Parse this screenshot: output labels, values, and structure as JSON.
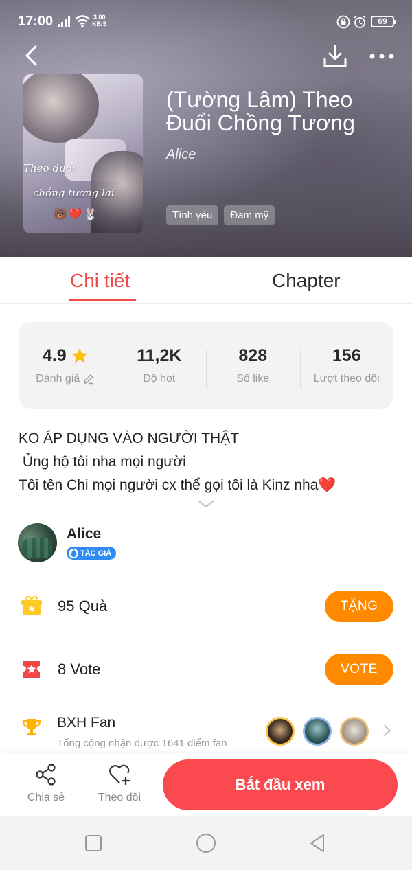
{
  "status_bar": {
    "time": "17:00",
    "speed_top": "3.00",
    "speed_bottom": "KB/S",
    "battery": "69"
  },
  "book": {
    "title": "(Tường Lâm) Theo Đuổi Chồng Tương",
    "author": "Alice",
    "cover_text_line1": "Theo đuổi",
    "cover_text_line2": "chồng tương lai",
    "cover_emoji": "🐻❤️🐰",
    "tags": [
      "Tình yêu",
      "Đam mỹ"
    ]
  },
  "tabs": [
    {
      "label": "Chi tiết",
      "active": true
    },
    {
      "label": "Chapter",
      "active": false
    }
  ],
  "stats": [
    {
      "value": "4.9",
      "label": "Đánh giá"
    },
    {
      "value": "11,2K",
      "label": "Độ hot"
    },
    {
      "value": "828",
      "label": "Số like"
    },
    {
      "value": "156",
      "label": "Lượt theo dõi"
    }
  ],
  "description": [
    "KO ÁP DỤNG VÀO NGƯỜI THẬT",
    " Ủng hộ tôi nha mọi người",
    "Tôi tên Chi mọi người cx thể gọi tôi là Kinz nha❤️"
  ],
  "author_section": {
    "name": "Alice",
    "badge": "TÁC GIẢ"
  },
  "gift_row": {
    "count": "95",
    "unit": "Quà",
    "button": "TẶNG"
  },
  "vote_row": {
    "count": "8",
    "unit": "Vote",
    "button": "VOTE"
  },
  "fan_row": {
    "title": "BXH Fan",
    "subtitle": "Tổng cộng nhận được 1641 điểm fan"
  },
  "bottom_bar": {
    "share": "Chia sẻ",
    "follow": "Theo dõi",
    "start": "Bắt đầu xem"
  },
  "colors": {
    "accent": "#f04747",
    "orange": "#ff8a00",
    "start_button": "#fa4a4f",
    "badge_blue": "#2f8cf5"
  }
}
